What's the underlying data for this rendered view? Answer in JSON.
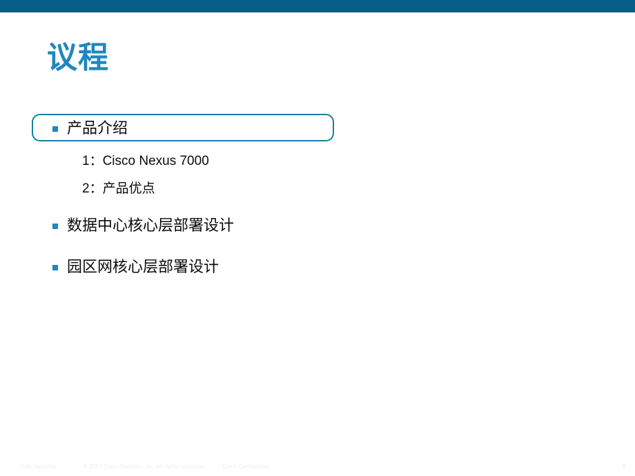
{
  "slide": {
    "title": "议程",
    "page_number": "3",
    "accent_color": "#075e86",
    "title_color": "#1f87bd",
    "bullet_color": "#1f87bd",
    "highlight_border_color": "#1b7ba5"
  },
  "agenda": {
    "items": [
      {
        "label": "产品介绍",
        "highlighted": true
      },
      {
        "label": "数据中心核心层部署设计",
        "highlighted": false
      },
      {
        "label": "园区网核心层部署设计",
        "highlighted": false
      }
    ],
    "sub_items": [
      {
        "label": "1：Cisco Nexus 7000"
      },
      {
        "label": "2：产品优点"
      }
    ]
  },
  "footer": {
    "deck_name": "SDN Overview",
    "copyright": "© 2007 Cisco Systems, Inc. All rights reserved.",
    "confidentiality": "Cisco Confidential"
  }
}
